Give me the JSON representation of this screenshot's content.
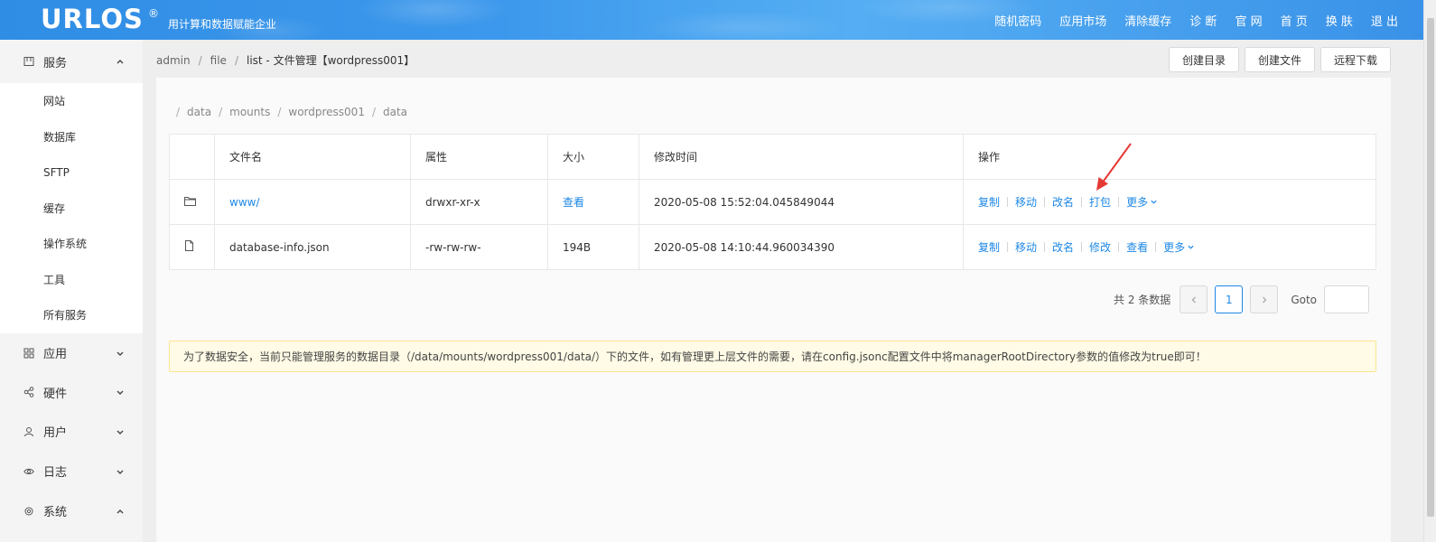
{
  "header": {
    "logo": "URLOS",
    "logo_mark": "®",
    "slogan": "用计算和数据赋能企业",
    "nav": [
      "随机密码",
      "应用市场",
      "清除缓存",
      "诊 断",
      "官 网",
      "首 页",
      "换 肤",
      "退 出"
    ]
  },
  "sidebar": {
    "service": {
      "label": "服务",
      "items": [
        "网站",
        "数据库",
        "SFTP",
        "缓存",
        "操作系统",
        "工具",
        "所有服务"
      ]
    },
    "groups": [
      "应用",
      "硬件",
      "用户",
      "日志",
      "系统"
    ]
  },
  "breadcrumb": {
    "items": [
      "admin",
      "file",
      "list"
    ],
    "current": "list",
    "title": " - 文件管理【wordpress001】"
  },
  "actions": [
    "创建目录",
    "创建文件",
    "远程下载"
  ],
  "path": [
    "data",
    "mounts",
    "wordpress001",
    "data"
  ],
  "table": {
    "headers": [
      "文件名",
      "属性",
      "大小",
      "修改时间",
      "操作"
    ],
    "rows": [
      {
        "name": "www/",
        "perm": "drwxr-xr-x",
        "size": "查看",
        "mtime": "2020-05-08 15:52:04.045849044",
        "ops": [
          "复制",
          "移动",
          "改名",
          "打包"
        ],
        "more": "更多"
      },
      {
        "name": "database-info.json",
        "perm": "-rw-rw-rw-",
        "size": "194B",
        "mtime": "2020-05-08 14:10:44.960034390",
        "ops": [
          "复制",
          "移动",
          "改名",
          "修改",
          "查看"
        ],
        "more": "更多"
      }
    ]
  },
  "pagination": {
    "total_text": "共 2 条数据",
    "current_page": "1",
    "goto_label": "Goto",
    "goto_value": ""
  },
  "notice": "为了数据安全，当前只能管理服务的数据目录（/data/mounts/wordpress001/data/）下的文件，如有管理更上层文件的需要，请在config.jsonc配置文件中将managerRootDirectory参数的值修改为true即可！",
  "colors": {
    "accent": "#1e88e5",
    "header": "#3a92e8",
    "notice_bg": "#fffbe6",
    "annotation": "#e53935"
  }
}
